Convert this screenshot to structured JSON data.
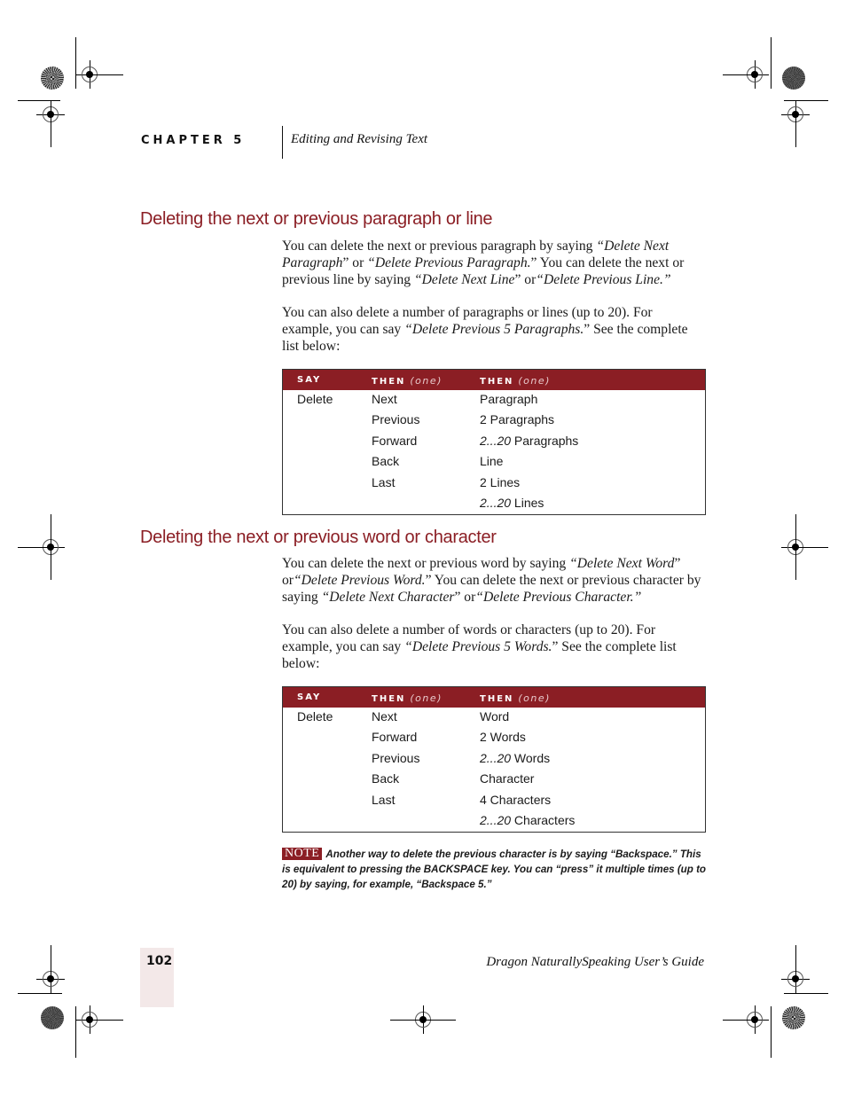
{
  "header": {
    "chapter_label": "CHAPTER 5",
    "chapter_title": "Editing and Revising Text"
  },
  "sections": [
    {
      "heading": "Deleting the next or previous paragraph or line",
      "paragraphs": [
        {
          "runs": [
            {
              "t": "You can delete the next or previous paragraph by saying ",
              "i": false
            },
            {
              "t": "“Delete Next Paragraph",
              "i": true
            },
            {
              "t": "” or ",
              "i": false
            },
            {
              "t": "“Delete Previous Paragraph.",
              "i": true
            },
            {
              "t": "” You can delete the next or previous line by saying ",
              "i": false
            },
            {
              "t": "“Delete Next Line",
              "i": true
            },
            {
              "t": "” or",
              "i": false
            },
            {
              "t": "“Delete Previous Line.”",
              "i": true
            }
          ]
        },
        {
          "runs": [
            {
              "t": "You can also delete a number of paragraphs or lines (up to 20). For example, you can say ",
              "i": false
            },
            {
              "t": "“Delete Previous 5 Paragraphs.",
              "i": true
            },
            {
              "t": "” See the complete list below:",
              "i": false
            }
          ]
        }
      ],
      "table": {
        "headers": [
          {
            "label": "SAY",
            "sub": ""
          },
          {
            "label": "THEN",
            "sub": "(one)"
          },
          {
            "label": "THEN",
            "sub": "(one)"
          }
        ],
        "col0": [
          "Delete"
        ],
        "col1": [
          "Next",
          "Previous",
          "Forward",
          "Back",
          "Last"
        ],
        "col2": [
          {
            "italic": "",
            "text": "Paragraph"
          },
          {
            "italic": "",
            "text": "2 Paragraphs"
          },
          {
            "italic": "2...20",
            "text": " Paragraphs"
          },
          {
            "italic": "",
            "text": "Line"
          },
          {
            "italic": "",
            "text": "2 Lines"
          },
          {
            "italic": "2...20",
            "text": " Lines"
          }
        ]
      }
    },
    {
      "heading": "Deleting the next or previous word or character",
      "paragraphs": [
        {
          "runs": [
            {
              "t": "You can delete the next or previous word by saying ",
              "i": false
            },
            {
              "t": "“Delete Next Word",
              "i": true
            },
            {
              "t": "” or",
              "i": false
            },
            {
              "t": "“Delete Previous Word.",
              "i": true
            },
            {
              "t": "” You can delete the next or previous character by saying ",
              "i": false
            },
            {
              "t": "“Delete Next Character",
              "i": true
            },
            {
              "t": "” or",
              "i": false
            },
            {
              "t": "“Delete Previous Character.”",
              "i": true
            }
          ]
        },
        {
          "runs": [
            {
              "t": "You can also delete a number of words or characters (up to 20). For example, you can say ",
              "i": false
            },
            {
              "t": "“Delete Previous 5 Words.",
              "i": true
            },
            {
              "t": "” See the complete list below:",
              "i": false
            }
          ]
        }
      ],
      "table": {
        "headers": [
          {
            "label": "SAY",
            "sub": ""
          },
          {
            "label": "THEN",
            "sub": "(one)"
          },
          {
            "label": "THEN",
            "sub": "(one)"
          }
        ],
        "col0": [
          "Delete"
        ],
        "col1": [
          "Next",
          "Forward",
          "Previous",
          "Back",
          "Last"
        ],
        "col2": [
          {
            "italic": "",
            "text": "Word"
          },
          {
            "italic": "",
            "text": "2 Words"
          },
          {
            "italic": "2...20",
            "text": " Words"
          },
          {
            "italic": "",
            "text": "Character"
          },
          {
            "italic": "",
            "text": "4 Characters"
          },
          {
            "italic": "2...20",
            "text": " Characters"
          }
        ]
      }
    }
  ],
  "note": {
    "badge": "NOTE",
    "text": "Another way to delete the previous character is by saying “Backspace.” This is equivalent to pressing the BACKSPACE key. You can “press” it multiple times (up to 20) by saying, for example, “Backspace 5.”"
  },
  "footer": {
    "page_number": "102",
    "book_title": "Dragon NaturallySpeaking User’s Guide"
  },
  "colors": {
    "accent": "#8b1e24",
    "page_tab": "#f3e8e8"
  }
}
